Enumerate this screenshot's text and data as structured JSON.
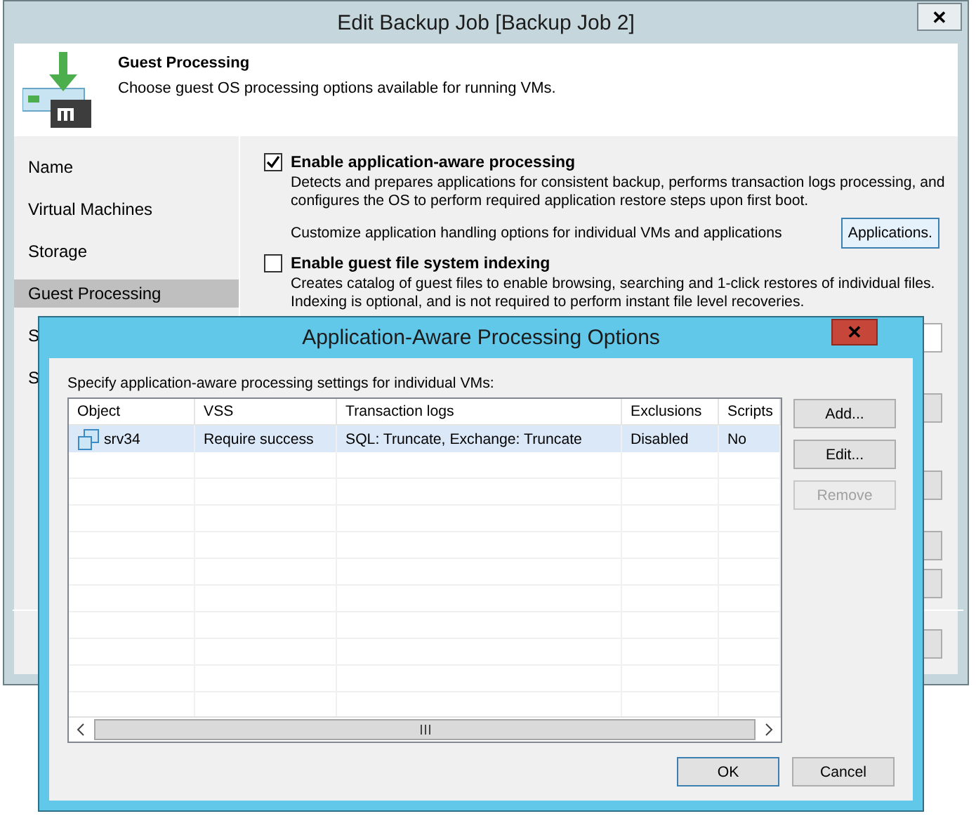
{
  "window": {
    "title": "Edit Backup Job [Backup Job 2]",
    "close": "✕"
  },
  "header": {
    "title": "Guest Processing",
    "subtitle": "Choose guest OS processing options available for running VMs."
  },
  "nav": [
    {
      "label": "Name",
      "selected": false
    },
    {
      "label": "Virtual Machines",
      "selected": false
    },
    {
      "label": "Storage",
      "selected": false
    },
    {
      "label": "Guest Processing",
      "selected": true
    },
    {
      "label": "S",
      "selected": false
    },
    {
      "label": "S",
      "selected": false
    }
  ],
  "options": [
    {
      "label": "Enable application-aware processing",
      "checked": true,
      "description": "Detects and prepares applications for consistent backup, performs transaction logs processing, and configures the OS to perform required application restore steps upon first boot.",
      "hint": "Customize application handling options for individual VMs and applications",
      "button": "Applications."
    },
    {
      "label": "Enable guest file system indexing",
      "checked": false,
      "description": "Creates catalog of guest files to enable browsing, searching and 1-click restores of individual files. Indexing is optional, and is not required to perform instant file level recoveries."
    }
  ],
  "dialog": {
    "title": "Application-Aware Processing Options",
    "close": "✕",
    "instruction": "Specify application-aware processing settings for individual VMs:",
    "table": {
      "columns": [
        "Object",
        "VSS",
        "Transaction logs",
        "Exclusions",
        "Scripts"
      ],
      "rows": [
        {
          "cells": [
            "srv34",
            "Require success",
            "SQL: Truncate, Exchange: Truncate",
            "Disabled",
            "No"
          ],
          "selected": true
        }
      ]
    },
    "side_buttons": [
      {
        "label": "Add...",
        "disabled": false
      },
      {
        "label": "Edit...",
        "disabled": false
      },
      {
        "label": "Remove",
        "disabled": true
      }
    ],
    "footer_buttons": [
      {
        "label": "OK",
        "default": true
      },
      {
        "label": "Cancel",
        "default": false
      }
    ]
  }
}
